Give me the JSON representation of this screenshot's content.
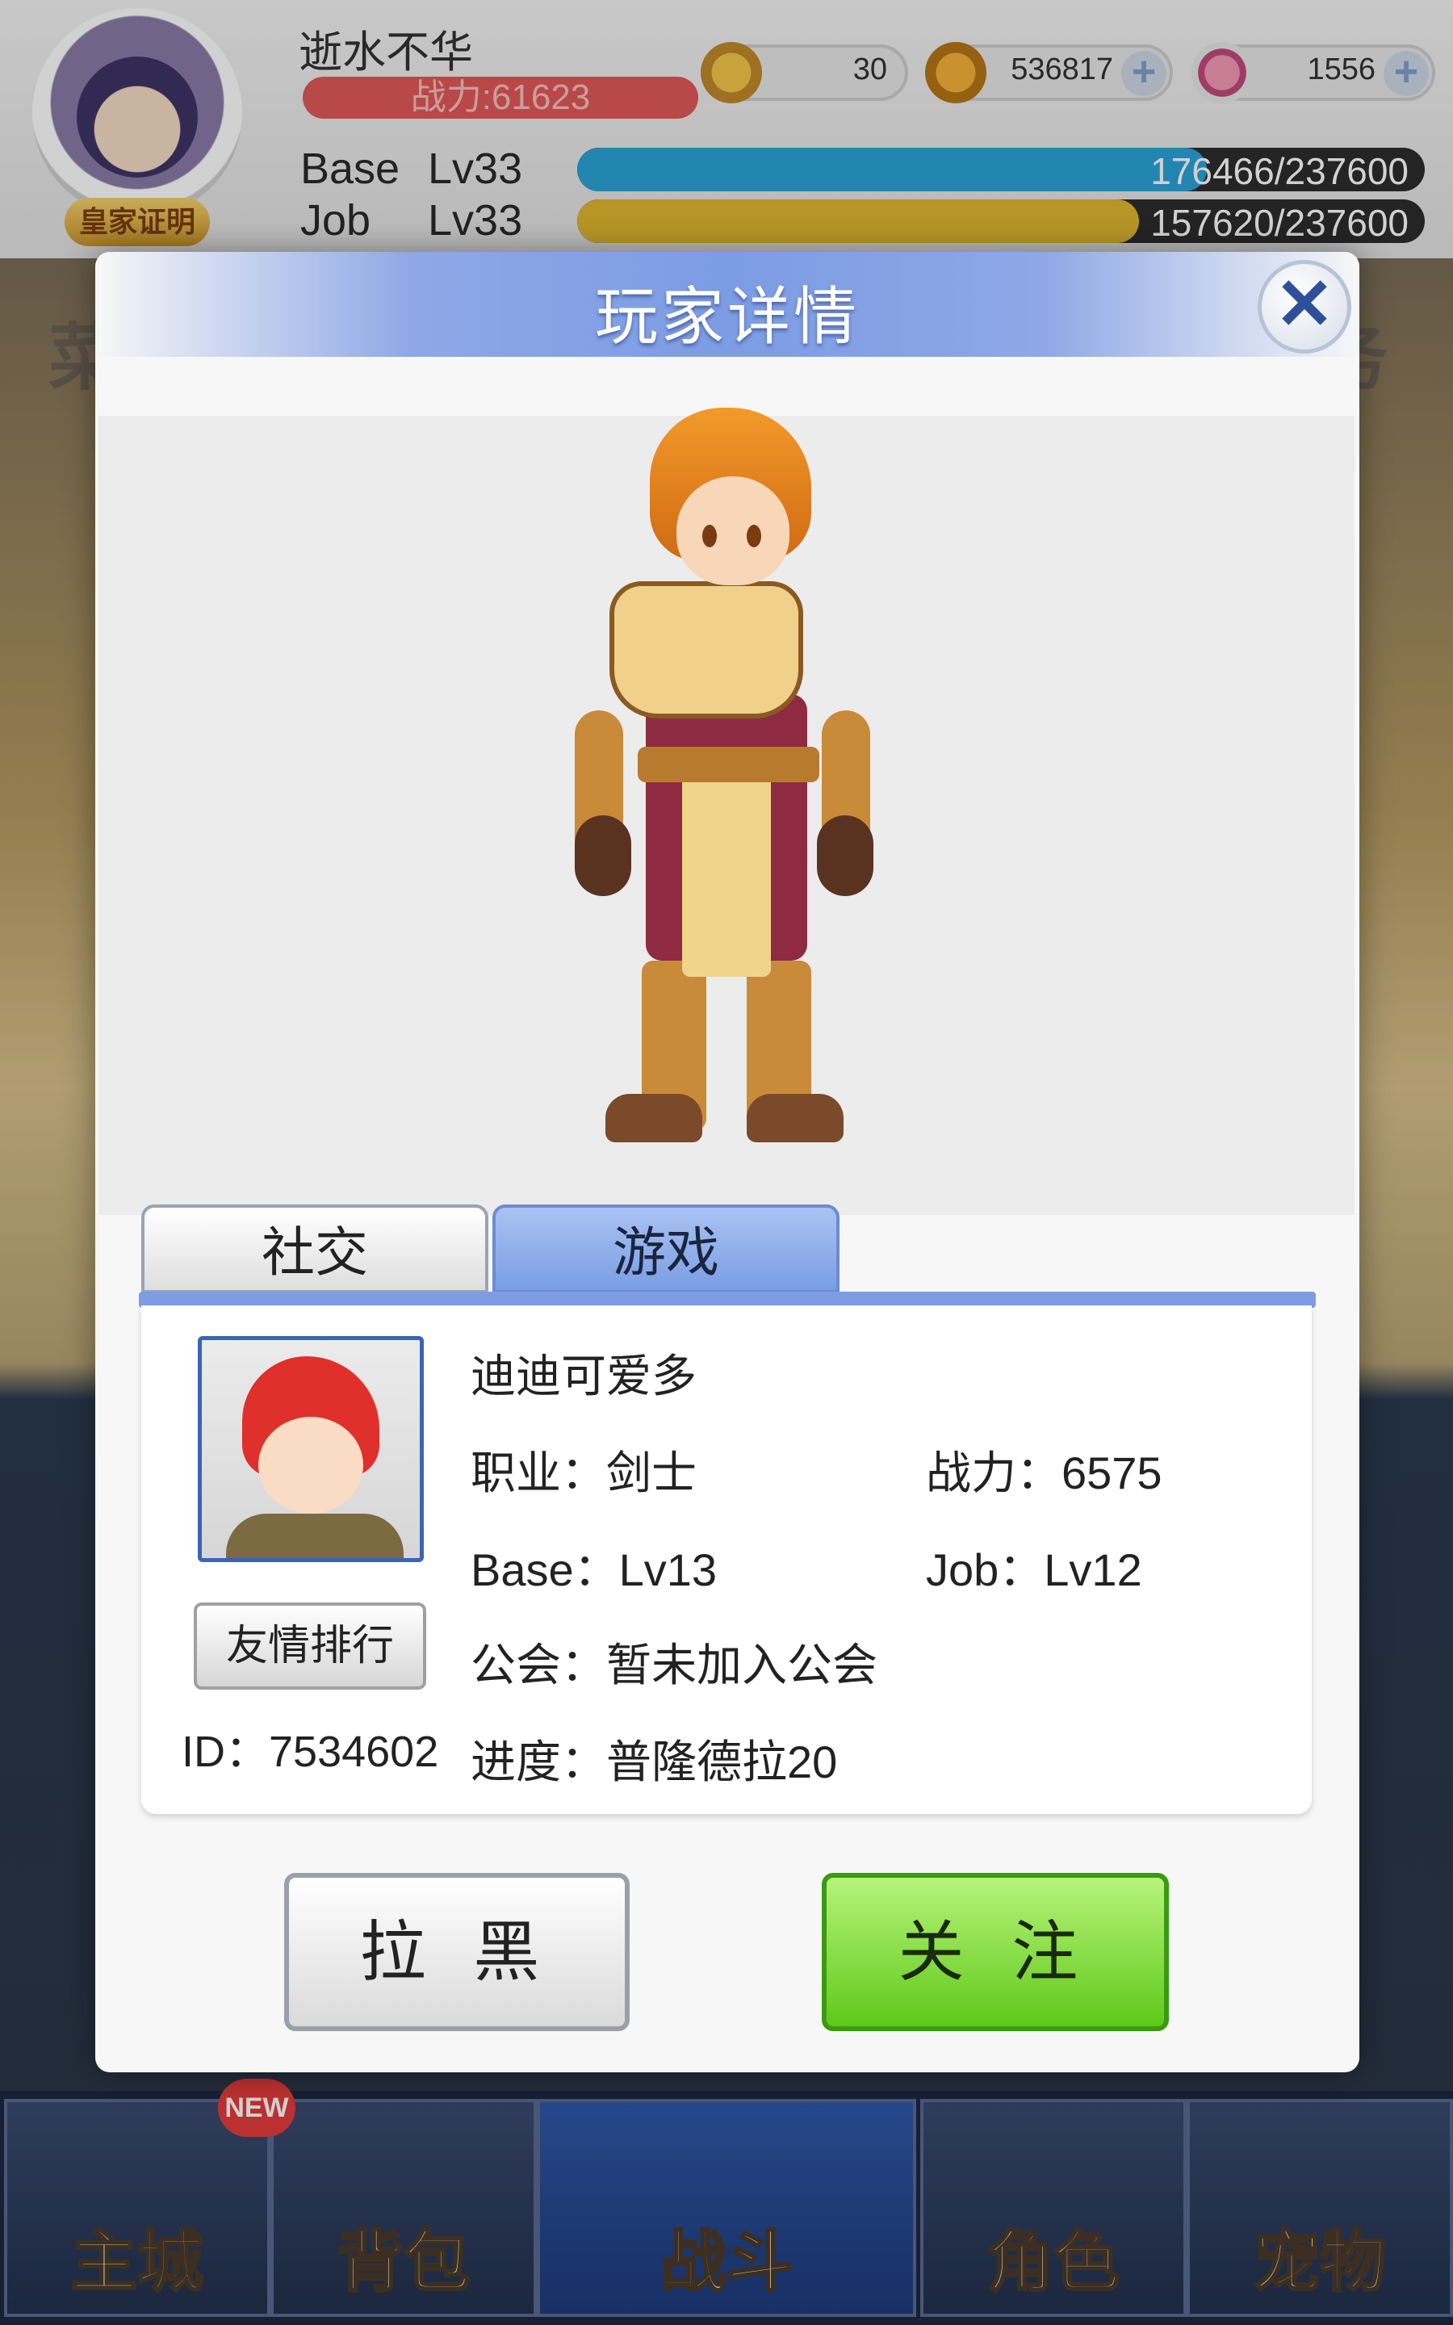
{
  "hud": {
    "player_name": "逝水不华",
    "power": "战力:61623",
    "badge": "皇家证明",
    "currency": [
      {
        "icon": "zeny-coin-icon",
        "value": "30"
      },
      {
        "icon": "gold-coin-icon",
        "value": "536817"
      },
      {
        "icon": "gem-icon",
        "value": "1556"
      }
    ],
    "base": {
      "label": "Base",
      "level": "Lv33",
      "exp": "176466/237600",
      "progress": 0.743,
      "color": "#2aa4d8"
    },
    "job": {
      "label": "Job",
      "level": "Lv33",
      "exp": "157620/237600",
      "progress": 0.663,
      "color": "#e0b630"
    },
    "bg_menu_left": "菜单",
    "bg_menu_right": "任务"
  },
  "nav": [
    {
      "label": "主城",
      "icon": "castle-icon"
    },
    {
      "label": "背包",
      "icon": "backpack-icon"
    },
    {
      "label": "战斗",
      "icon": "battle-wheel-icon"
    },
    {
      "label": "角色",
      "icon": "character-icon"
    },
    {
      "label": "宠物",
      "icon": "pet-icon"
    }
  ],
  "nav_new_badge": "NEW",
  "modal": {
    "title": "玩家详情",
    "tabs": [
      {
        "label": "社交",
        "active": false
      },
      {
        "label": "游戏",
        "active": true
      }
    ],
    "friend_rank_button": "友情排行",
    "id_label": "ID：",
    "id_value": "7534602",
    "name": "迪迪可爱多",
    "job": "职业：剑士",
    "power": "战力：6575",
    "base": "Base：Lv13",
    "job_level": "Job：Lv12",
    "guild": "公会：暂未加入公会",
    "progress": "进度：普隆德拉20",
    "block_button": "拉 黑",
    "follow_button": "关 注"
  }
}
